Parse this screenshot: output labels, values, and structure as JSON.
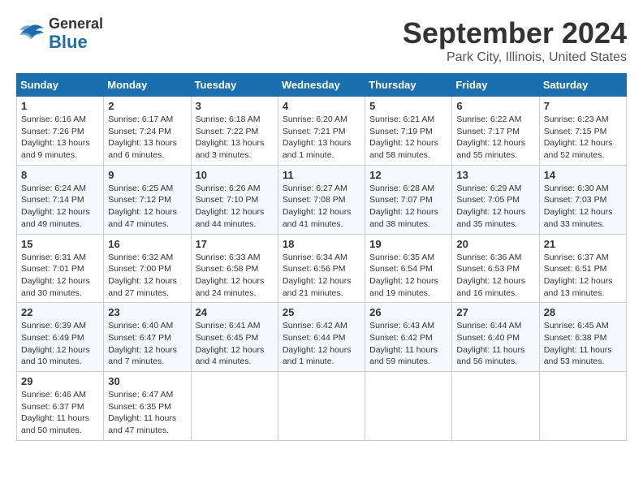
{
  "header": {
    "logo_general": "General",
    "logo_blue": "Blue",
    "month_title": "September 2024",
    "location": "Park City, Illinois, United States"
  },
  "weekdays": [
    "Sunday",
    "Monday",
    "Tuesday",
    "Wednesday",
    "Thursday",
    "Friday",
    "Saturday"
  ],
  "weeks": [
    [
      {
        "day": "1",
        "sunrise": "Sunrise: 6:16 AM",
        "sunset": "Sunset: 7:26 PM",
        "daylight": "Daylight: 13 hours and 9 minutes."
      },
      {
        "day": "2",
        "sunrise": "Sunrise: 6:17 AM",
        "sunset": "Sunset: 7:24 PM",
        "daylight": "Daylight: 13 hours and 6 minutes."
      },
      {
        "day": "3",
        "sunrise": "Sunrise: 6:18 AM",
        "sunset": "Sunset: 7:22 PM",
        "daylight": "Daylight: 13 hours and 3 minutes."
      },
      {
        "day": "4",
        "sunrise": "Sunrise: 6:20 AM",
        "sunset": "Sunset: 7:21 PM",
        "daylight": "Daylight: 13 hours and 1 minute."
      },
      {
        "day": "5",
        "sunrise": "Sunrise: 6:21 AM",
        "sunset": "Sunset: 7:19 PM",
        "daylight": "Daylight: 12 hours and 58 minutes."
      },
      {
        "day": "6",
        "sunrise": "Sunrise: 6:22 AM",
        "sunset": "Sunset: 7:17 PM",
        "daylight": "Daylight: 12 hours and 55 minutes."
      },
      {
        "day": "7",
        "sunrise": "Sunrise: 6:23 AM",
        "sunset": "Sunset: 7:15 PM",
        "daylight": "Daylight: 12 hours and 52 minutes."
      }
    ],
    [
      {
        "day": "8",
        "sunrise": "Sunrise: 6:24 AM",
        "sunset": "Sunset: 7:14 PM",
        "daylight": "Daylight: 12 hours and 49 minutes."
      },
      {
        "day": "9",
        "sunrise": "Sunrise: 6:25 AM",
        "sunset": "Sunset: 7:12 PM",
        "daylight": "Daylight: 12 hours and 47 minutes."
      },
      {
        "day": "10",
        "sunrise": "Sunrise: 6:26 AM",
        "sunset": "Sunset: 7:10 PM",
        "daylight": "Daylight: 12 hours and 44 minutes."
      },
      {
        "day": "11",
        "sunrise": "Sunrise: 6:27 AM",
        "sunset": "Sunset: 7:08 PM",
        "daylight": "Daylight: 12 hours and 41 minutes."
      },
      {
        "day": "12",
        "sunrise": "Sunrise: 6:28 AM",
        "sunset": "Sunset: 7:07 PM",
        "daylight": "Daylight: 12 hours and 38 minutes."
      },
      {
        "day": "13",
        "sunrise": "Sunrise: 6:29 AM",
        "sunset": "Sunset: 7:05 PM",
        "daylight": "Daylight: 12 hours and 35 minutes."
      },
      {
        "day": "14",
        "sunrise": "Sunrise: 6:30 AM",
        "sunset": "Sunset: 7:03 PM",
        "daylight": "Daylight: 12 hours and 33 minutes."
      }
    ],
    [
      {
        "day": "15",
        "sunrise": "Sunrise: 6:31 AM",
        "sunset": "Sunset: 7:01 PM",
        "daylight": "Daylight: 12 hours and 30 minutes."
      },
      {
        "day": "16",
        "sunrise": "Sunrise: 6:32 AM",
        "sunset": "Sunset: 7:00 PM",
        "daylight": "Daylight: 12 hours and 27 minutes."
      },
      {
        "day": "17",
        "sunrise": "Sunrise: 6:33 AM",
        "sunset": "Sunset: 6:58 PM",
        "daylight": "Daylight: 12 hours and 24 minutes."
      },
      {
        "day": "18",
        "sunrise": "Sunrise: 6:34 AM",
        "sunset": "Sunset: 6:56 PM",
        "daylight": "Daylight: 12 hours and 21 minutes."
      },
      {
        "day": "19",
        "sunrise": "Sunrise: 6:35 AM",
        "sunset": "Sunset: 6:54 PM",
        "daylight": "Daylight: 12 hours and 19 minutes."
      },
      {
        "day": "20",
        "sunrise": "Sunrise: 6:36 AM",
        "sunset": "Sunset: 6:53 PM",
        "daylight": "Daylight: 12 hours and 16 minutes."
      },
      {
        "day": "21",
        "sunrise": "Sunrise: 6:37 AM",
        "sunset": "Sunset: 6:51 PM",
        "daylight": "Daylight: 12 hours and 13 minutes."
      }
    ],
    [
      {
        "day": "22",
        "sunrise": "Sunrise: 6:39 AM",
        "sunset": "Sunset: 6:49 PM",
        "daylight": "Daylight: 12 hours and 10 minutes."
      },
      {
        "day": "23",
        "sunrise": "Sunrise: 6:40 AM",
        "sunset": "Sunset: 6:47 PM",
        "daylight": "Daylight: 12 hours and 7 minutes."
      },
      {
        "day": "24",
        "sunrise": "Sunrise: 6:41 AM",
        "sunset": "Sunset: 6:45 PM",
        "daylight": "Daylight: 12 hours and 4 minutes."
      },
      {
        "day": "25",
        "sunrise": "Sunrise: 6:42 AM",
        "sunset": "Sunset: 6:44 PM",
        "daylight": "Daylight: 12 hours and 1 minute."
      },
      {
        "day": "26",
        "sunrise": "Sunrise: 6:43 AM",
        "sunset": "Sunset: 6:42 PM",
        "daylight": "Daylight: 11 hours and 59 minutes."
      },
      {
        "day": "27",
        "sunrise": "Sunrise: 6:44 AM",
        "sunset": "Sunset: 6:40 PM",
        "daylight": "Daylight: 11 hours and 56 minutes."
      },
      {
        "day": "28",
        "sunrise": "Sunrise: 6:45 AM",
        "sunset": "Sunset: 6:38 PM",
        "daylight": "Daylight: 11 hours and 53 minutes."
      }
    ],
    [
      {
        "day": "29",
        "sunrise": "Sunrise: 6:46 AM",
        "sunset": "Sunset: 6:37 PM",
        "daylight": "Daylight: 11 hours and 50 minutes."
      },
      {
        "day": "30",
        "sunrise": "Sunrise: 6:47 AM",
        "sunset": "Sunset: 6:35 PM",
        "daylight": "Daylight: 11 hours and 47 minutes."
      },
      null,
      null,
      null,
      null,
      null
    ]
  ]
}
